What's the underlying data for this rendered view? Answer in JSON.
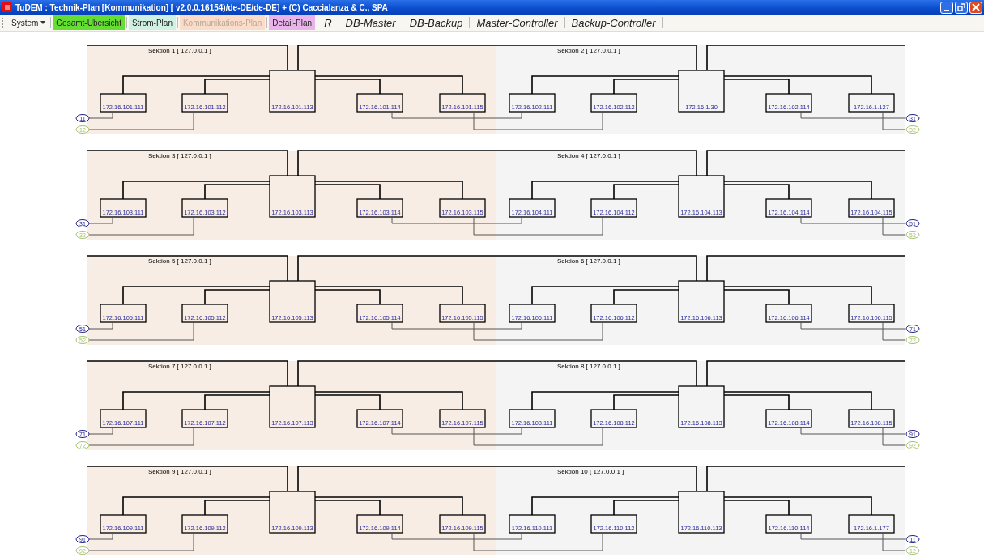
{
  "window": {
    "title": "TuDEM : Technik-Plan [Kommunikation] [ v2.0.0.16154)/de-DE/de-DE] + (C) Caccialanza & C., SPA"
  },
  "toolbar": [
    {
      "kind": "menu",
      "label": "System"
    },
    {
      "kind": "plan",
      "label": "Gesamt-Übersicht",
      "color": "#66dd33",
      "selected": false
    },
    {
      "kind": "plan",
      "label": "Strom-Plan",
      "color": "#cff0e2",
      "selected": false
    },
    {
      "kind": "plan",
      "label": "Kommunikations-Plan",
      "color": "#fbdcc8",
      "selected": true
    },
    {
      "kind": "plan",
      "label": "Detail-Plan",
      "color": "#e9b4ea",
      "selected": false
    },
    {
      "kind": "tool",
      "label": "R",
      "selected": false
    },
    {
      "kind": "tool",
      "label": "DB-Master",
      "selected": false
    },
    {
      "kind": "tool",
      "label": "DB-Backup",
      "selected": false
    },
    {
      "kind": "tool",
      "label": "Master-Controller",
      "selected": false
    },
    {
      "kind": "tool",
      "label": "Backup-Controller",
      "selected": false
    }
  ],
  "rows": [
    {
      "left_ports": [
        {
          "label": "11",
          "color": "#20208a"
        },
        {
          "label": "12",
          "color": "#a8c070"
        }
      ],
      "right_ports": [
        {
          "label": "31",
          "color": "#20208a"
        },
        {
          "label": "32",
          "color": "#a8c070"
        }
      ],
      "sections": [
        {
          "label": "Sektion 1 [ 127.0.0.1 ]",
          "color": "#f8ede4",
          "nodes": [
            "172.16.101.111",
            "172.16.101.112",
            "172.16.101.113",
            "172.16.101.114",
            "172.16.101.115"
          ]
        },
        {
          "label": "Sektion 2 [ 127.0.0.1 ]",
          "color": "#f4f4f4",
          "nodes": [
            "172.16.102.111",
            "172.16.102.112",
            "172.16.1.30",
            "172.16.102.114",
            "172.16.1.127"
          ]
        }
      ]
    },
    {
      "left_ports": [
        {
          "label": "31",
          "color": "#20208a"
        },
        {
          "label": "32",
          "color": "#a8c070"
        }
      ],
      "right_ports": [
        {
          "label": "51",
          "color": "#20208a"
        },
        {
          "label": "52",
          "color": "#a8c070"
        }
      ],
      "sections": [
        {
          "label": "Sektion 3 [ 127.0.0.1 ]",
          "color": "#f8ede4",
          "nodes": [
            "172.16.103.111",
            "172.16.103.112",
            "172.16.103.113",
            "172.16.103.114",
            "172.16.103.115"
          ]
        },
        {
          "label": "Sektion 4 [ 127.0.0.1 ]",
          "color": "#f4f4f4",
          "nodes": [
            "172.16.104.111",
            "172.16.104.112",
            "172.16.104.113",
            "172.16.104.114",
            "172.16.104.115"
          ]
        }
      ]
    },
    {
      "left_ports": [
        {
          "label": "51",
          "color": "#20208a"
        },
        {
          "label": "52",
          "color": "#a8c070"
        }
      ],
      "right_ports": [
        {
          "label": "71",
          "color": "#20208a"
        },
        {
          "label": "72",
          "color": "#a8c070"
        }
      ],
      "sections": [
        {
          "label": "Sektion 5 [ 127.0.0.1 ]",
          "color": "#f8ede4",
          "nodes": [
            "172.16.105.111",
            "172.16.105.112",
            "172.16.105.113",
            "172.16.105.114",
            "172.16.105.115"
          ]
        },
        {
          "label": "Sektion 6 [ 127.0.0.1 ]",
          "color": "#f4f4f4",
          "nodes": [
            "172.16.106.111",
            "172.16.106.112",
            "172.16.106.113",
            "172.16.106.114",
            "172.16.106.115"
          ]
        }
      ]
    },
    {
      "left_ports": [
        {
          "label": "71",
          "color": "#20208a"
        },
        {
          "label": "72",
          "color": "#a8c070"
        }
      ],
      "right_ports": [
        {
          "label": "91",
          "color": "#20208a"
        },
        {
          "label": "92",
          "color": "#a8c070"
        }
      ],
      "sections": [
        {
          "label": "Sektion 7 [ 127.0.0.1 ]",
          "color": "#f8ede4",
          "nodes": [
            "172.16.107.111",
            "172.16.107.112",
            "172.16.107.113",
            "172.16.107.114",
            "172.16.107.115"
          ]
        },
        {
          "label": "Sektion 8 [ 127.0.0.1 ]",
          "color": "#f4f4f4",
          "nodes": [
            "172.16.108.111",
            "172.16.108.112",
            "172.16.108.113",
            "172.16.108.114",
            "172.16.108.115"
          ]
        }
      ]
    },
    {
      "left_ports": [
        {
          "label": "91",
          "color": "#20208a"
        },
        {
          "label": "92",
          "color": "#a8c070"
        }
      ],
      "right_ports": [
        {
          "label": "11",
          "color": "#20208a"
        },
        {
          "label": "12",
          "color": "#a8c070"
        }
      ],
      "sections": [
        {
          "label": "Sektion 9 [ 127.0.0.1 ]",
          "color": "#f8ede4",
          "nodes": [
            "172.16.109.111",
            "172.16.109.112",
            "172.16.109.113",
            "172.16.109.114",
            "172.16.109.115"
          ]
        },
        {
          "label": "Sektion 10 [ 127.0.0.1 ]",
          "color": "#f4f4f4",
          "nodes": [
            "172.16.110.111",
            "172.16.110.112",
            "172.16.110.113",
            "172.16.110.114",
            "172.16.1.177"
          ]
        }
      ]
    }
  ]
}
